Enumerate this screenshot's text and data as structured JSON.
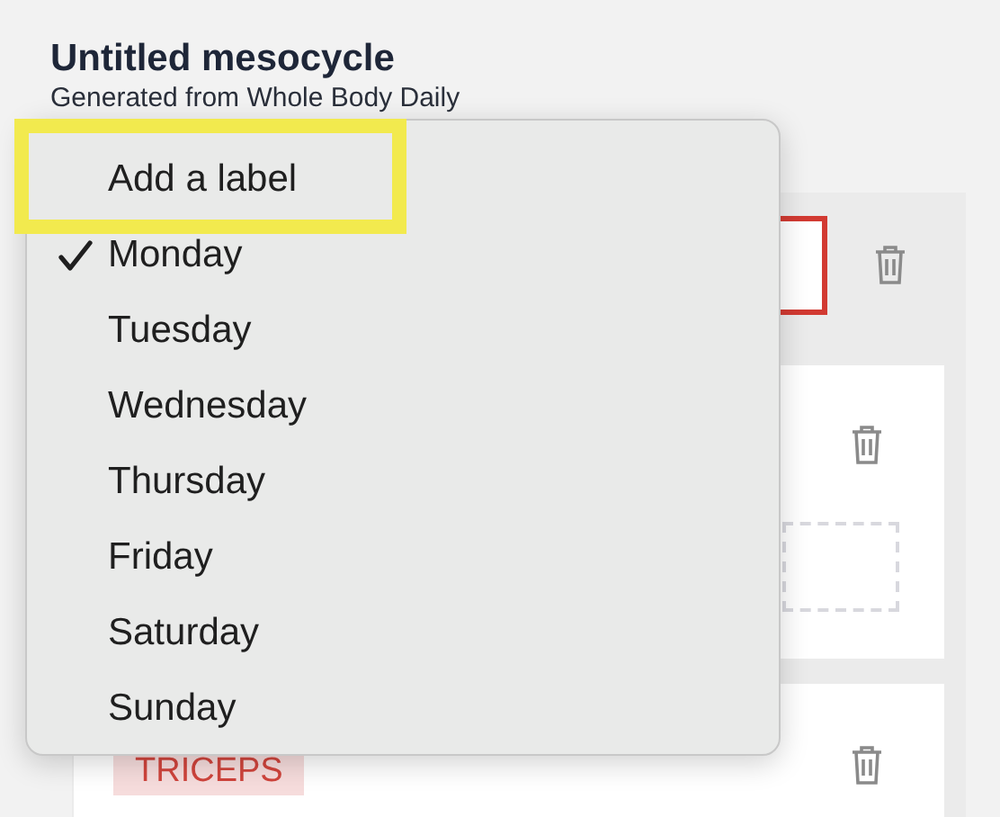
{
  "header": {
    "title": "Untitled mesocycle",
    "subtitle": "Generated from Whole Body Daily"
  },
  "cards": [
    {
      "kind": "label-box"
    },
    {
      "kind": "slot"
    },
    {
      "kind": "tag",
      "tag": "TRICEPS"
    }
  ],
  "menu": {
    "items": [
      {
        "label": "Add a label",
        "checked": false,
        "highlighted": true
      },
      {
        "label": "Monday",
        "checked": true,
        "highlighted": false
      },
      {
        "label": "Tuesday",
        "checked": false,
        "highlighted": false
      },
      {
        "label": "Wednesday",
        "checked": false,
        "highlighted": false
      },
      {
        "label": "Thursday",
        "checked": false,
        "highlighted": false
      },
      {
        "label": "Friday",
        "checked": false,
        "highlighted": false
      },
      {
        "label": "Saturday",
        "checked": false,
        "highlighted": false
      },
      {
        "label": "Sunday",
        "checked": false,
        "highlighted": false
      }
    ]
  }
}
